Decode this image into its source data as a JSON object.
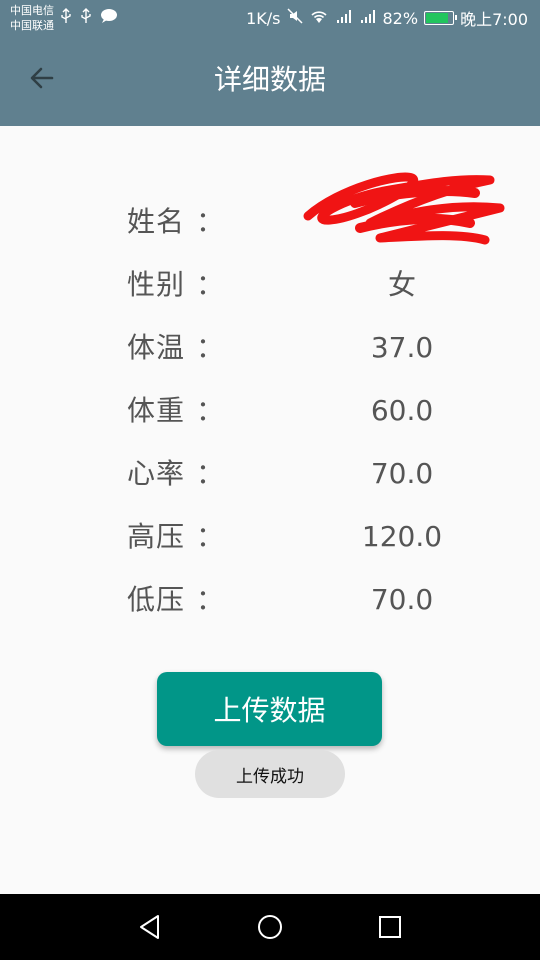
{
  "status_bar": {
    "carrier_1": "中国电信",
    "carrier_2": "中国联通",
    "network_speed": "1K/s",
    "battery": "82%",
    "time": "晚上7:00",
    "battery_color": "#22c55e",
    "icons": [
      "usb-icon",
      "usb-icon",
      "message-icon",
      "mute-icon",
      "wifi-icon",
      "signal-icon",
      "signal-icon",
      "battery-icon"
    ]
  },
  "toolbar": {
    "title": "详细数据",
    "background": "#60808f"
  },
  "details": [
    {
      "label": "姓名",
      "colon": "：",
      "value": ""
    },
    {
      "label": "性别",
      "colon": "：",
      "value": "女"
    },
    {
      "label": "体温",
      "colon": "：",
      "value": "37.0"
    },
    {
      "label": "体重",
      "colon": "：",
      "value": "60.0"
    },
    {
      "label": "心率",
      "colon": "：",
      "value": "70.0"
    },
    {
      "label": "高压",
      "colon": "：",
      "value": "120.0"
    },
    {
      "label": "低压",
      "colon": "：",
      "value": "70.0"
    }
  ],
  "upload_button": {
    "label": "上传数据",
    "color": "#019688"
  },
  "toast": {
    "message": "上传成功"
  },
  "nav_bar": {
    "icons": [
      "back-triangle-icon",
      "home-circle-icon",
      "recents-square-icon"
    ]
  }
}
